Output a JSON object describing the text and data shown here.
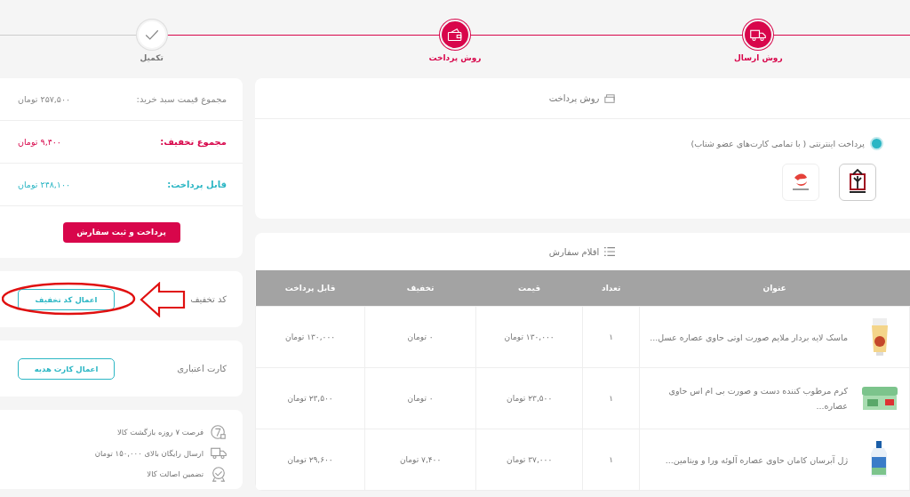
{
  "steps": [
    {
      "label": "روش ارسال",
      "done": true
    },
    {
      "label": "روش پرداخت",
      "done": true
    },
    {
      "label": "تکمیل",
      "done": false
    }
  ],
  "summary": {
    "rows": [
      {
        "label": "مجموع قیمت سبد خرید:",
        "value": "۲۵۷,۵۰۰ تومان",
        "kind": "total"
      },
      {
        "label": "مجموع تخفیف:",
        "value": "۹,۴۰۰ تومان",
        "kind": "discount"
      },
      {
        "label": "قابل پرداخت:",
        "value": "۲۴۸,۱۰۰ تومان",
        "kind": "payable"
      }
    ],
    "button": "پرداخت و ثبت سفارش"
  },
  "discount_code": {
    "label": "کد تخفیف",
    "button": "اعمال کد تخفیف"
  },
  "gift_card": {
    "label": "کارت اعتباری",
    "button": "اعمال کارت هدیه"
  },
  "features": [
    {
      "text": "فرصت ۷ روزه بازگشت کالا"
    },
    {
      "text": "ارسال رایگان بالای ۱۵۰,۰۰۰ تومان"
    },
    {
      "text": "تضمین اصالت کالا"
    }
  ],
  "payment": {
    "title": "روش پرداخت",
    "options": [
      {
        "label": "پرداخت اینترنتی ( با تمامی کارت‌های عضو شتاب)",
        "selected": true
      }
    ]
  },
  "order": {
    "title": "اقلام سفارش",
    "columns": [
      "عنوان",
      "تعداد",
      "قیمت",
      "تخفیف",
      "قابل پرداخت"
    ],
    "rows": [
      {
        "title": "ماسک لایه بردار ملایم صورت اوتی حاوی عصاره عسل...",
        "quantity": "۱",
        "price": "۱۳۰,۰۰۰ تومان",
        "discount": "۰ تومان",
        "payable": "۱۳۰,۰۰۰ تومان",
        "kind": "tube"
      },
      {
        "title": "کرم مرطوب کننده دست و صورت بی ام اس حاوی عصاره...",
        "quantity": "۱",
        "price": "۲۳,۵۰۰ تومان",
        "discount": "۰ تومان",
        "payable": "۲۳,۵۰۰ تومان",
        "kind": "jar"
      },
      {
        "title": "ژل آبرسان کامان حاوی عصاره آلوئه ورا و ویتامین...",
        "quantity": "۱",
        "price": "۳۷,۰۰۰ تومان",
        "discount": "۷,۴۰۰ تومان",
        "payable": "۲۹,۶۰۰ تومان",
        "kind": "bottle"
      }
    ]
  }
}
